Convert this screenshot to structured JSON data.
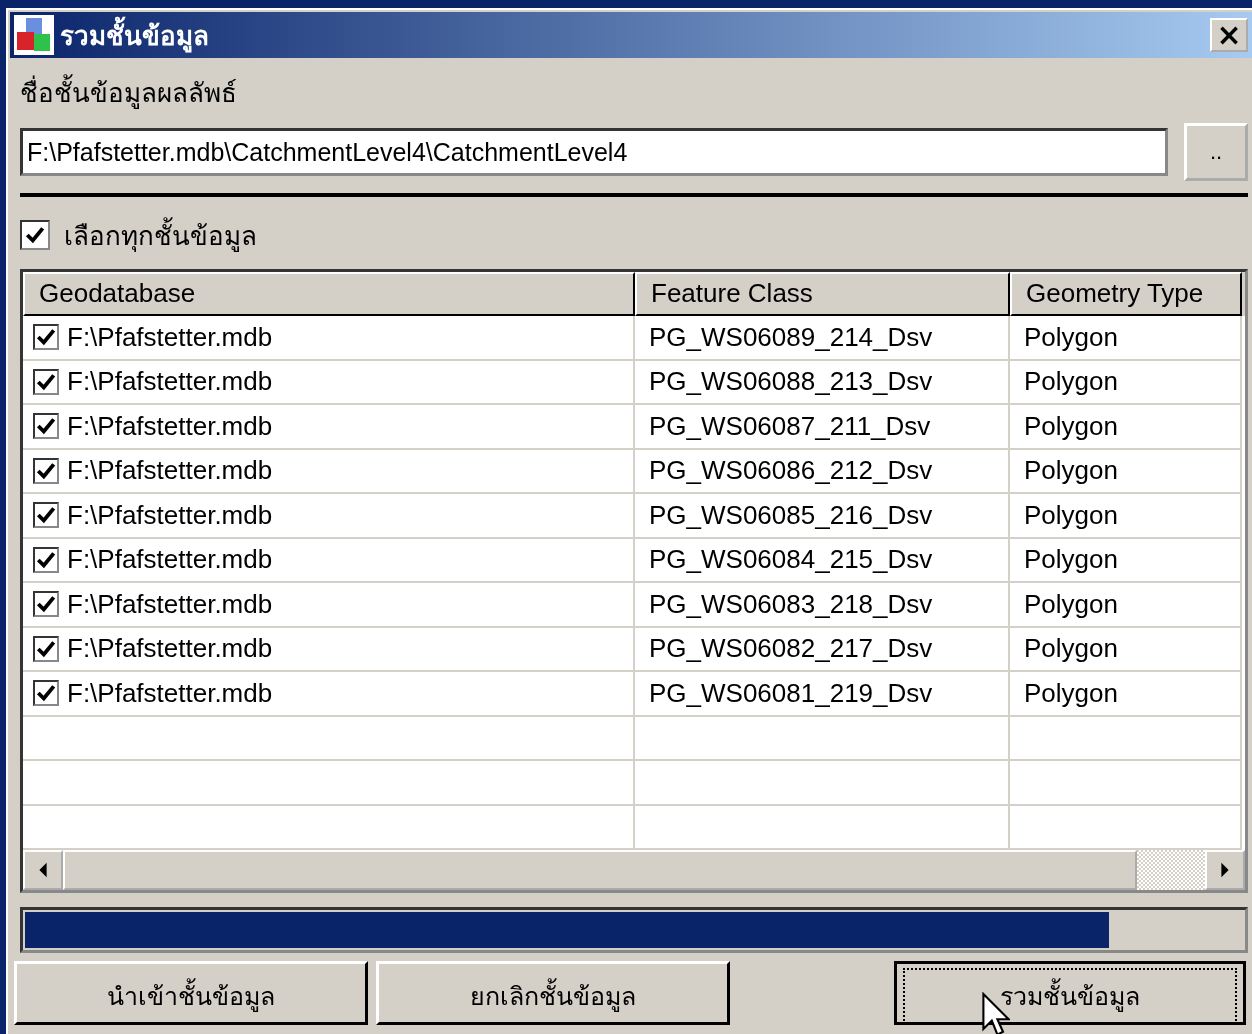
{
  "window": {
    "title": "รวมชั้นข้อมูล",
    "close": "×"
  },
  "output": {
    "label": "ชื่อชั้นข้อมูลผลลัพธ์",
    "value": "F:\\Pfafstetter.mdb\\CatchmentLevel4\\CatchmentLevel4",
    "browse": ".."
  },
  "select_all": {
    "label": "เลือกทุกชั้นข้อมูล",
    "checked": true
  },
  "table": {
    "columns": [
      "Geodatabase",
      "Feature Class",
      "Geometry Type"
    ],
    "rows": [
      {
        "checked": true,
        "geodatabase": "F:\\Pfafstetter.mdb",
        "feature_class": "PG_WS06089_214_Dsv",
        "geometry_type": "Polygon"
      },
      {
        "checked": true,
        "geodatabase": "F:\\Pfafstetter.mdb",
        "feature_class": "PG_WS06088_213_Dsv",
        "geometry_type": "Polygon"
      },
      {
        "checked": true,
        "geodatabase": "F:\\Pfafstetter.mdb",
        "feature_class": "PG_WS06087_211_Dsv",
        "geometry_type": "Polygon"
      },
      {
        "checked": true,
        "geodatabase": "F:\\Pfafstetter.mdb",
        "feature_class": "PG_WS06086_212_Dsv",
        "geometry_type": "Polygon"
      },
      {
        "checked": true,
        "geodatabase": "F:\\Pfafstetter.mdb",
        "feature_class": "PG_WS06085_216_Dsv",
        "geometry_type": "Polygon"
      },
      {
        "checked": true,
        "geodatabase": "F:\\Pfafstetter.mdb",
        "feature_class": "PG_WS06084_215_Dsv",
        "geometry_type": "Polygon"
      },
      {
        "checked": true,
        "geodatabase": "F:\\Pfafstetter.mdb",
        "feature_class": "PG_WS06083_218_Dsv",
        "geometry_type": "Polygon"
      },
      {
        "checked": true,
        "geodatabase": "F:\\Pfafstetter.mdb",
        "feature_class": "PG_WS06082_217_Dsv",
        "geometry_type": "Polygon"
      },
      {
        "checked": true,
        "geodatabase": "F:\\Pfafstetter.mdb",
        "feature_class": "PG_WS06081_219_Dsv",
        "geometry_type": "Polygon"
      }
    ]
  },
  "progress": {
    "level": 0.89
  },
  "buttons": [
    {
      "label": "นำเข้าชั้นข้อมูล",
      "focused": false
    },
    {
      "label": "ยกเลิกชั้นข้อมูล",
      "focused": false
    },
    {
      "label": "รวมชั้นข้อมูล",
      "focused": true
    }
  ]
}
